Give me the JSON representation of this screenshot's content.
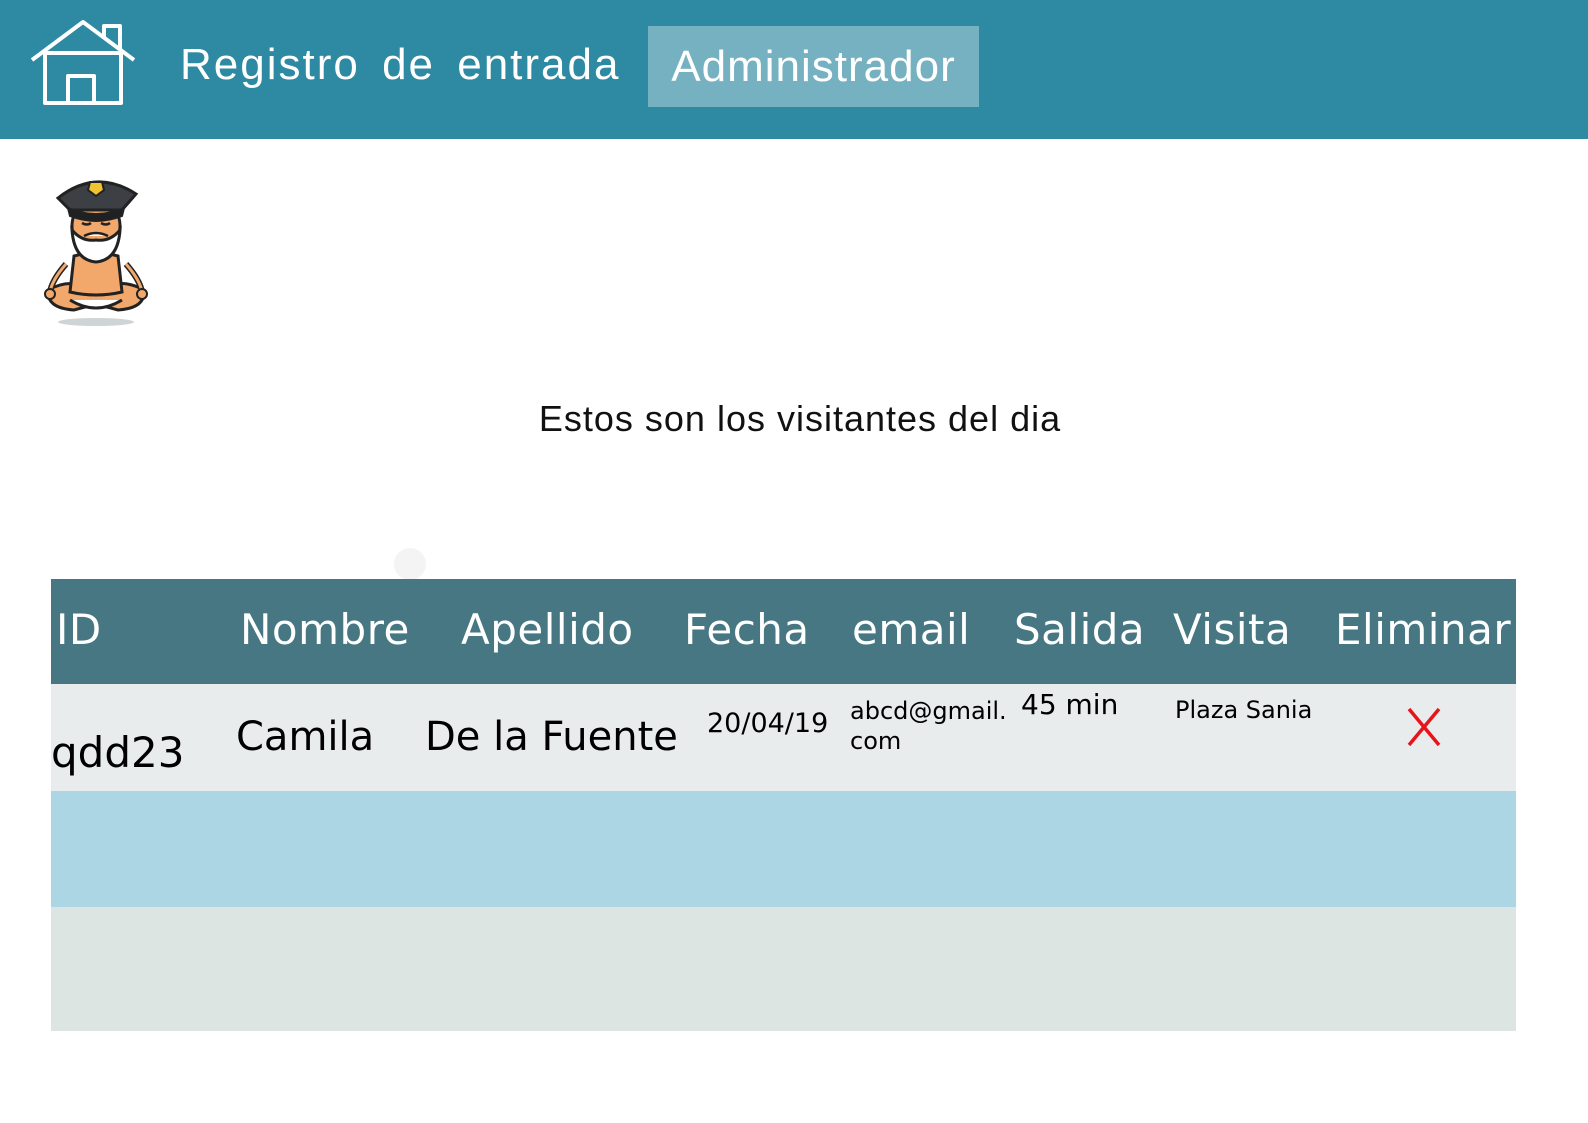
{
  "header": {
    "title": "Registro  de  entrada",
    "admin_label": "Administrador",
    "home_icon": "home-icon"
  },
  "avatar": {
    "icon": "police-guard-avatar"
  },
  "subtitle": "Estos son los visitantes del dia",
  "table": {
    "columns": [
      "ID",
      "Nombre",
      "Apellido",
      "Fecha",
      "email",
      "Salida",
      "Visita",
      "Eliminar"
    ],
    "rows": [
      {
        "id": "qdd23",
        "nombre": "Camila",
        "apellido": "De la Fuente",
        "fecha": "20/04/19",
        "email_line1": "abcd@gmail.",
        "email_line2": "com",
        "salida": "45 min",
        "visita": "Plaza Sania",
        "eliminar_icon": "delete-x-icon"
      }
    ]
  },
  "colors": {
    "header_bg": "#2e8aa2",
    "admin_bg": "#76b1c2",
    "table_header_bg": "#467782",
    "row1_bg": "#e8ecec",
    "row2_bg": "#acd6e3",
    "row3_bg": "#dde5e3",
    "delete_red": "#e8141b"
  }
}
